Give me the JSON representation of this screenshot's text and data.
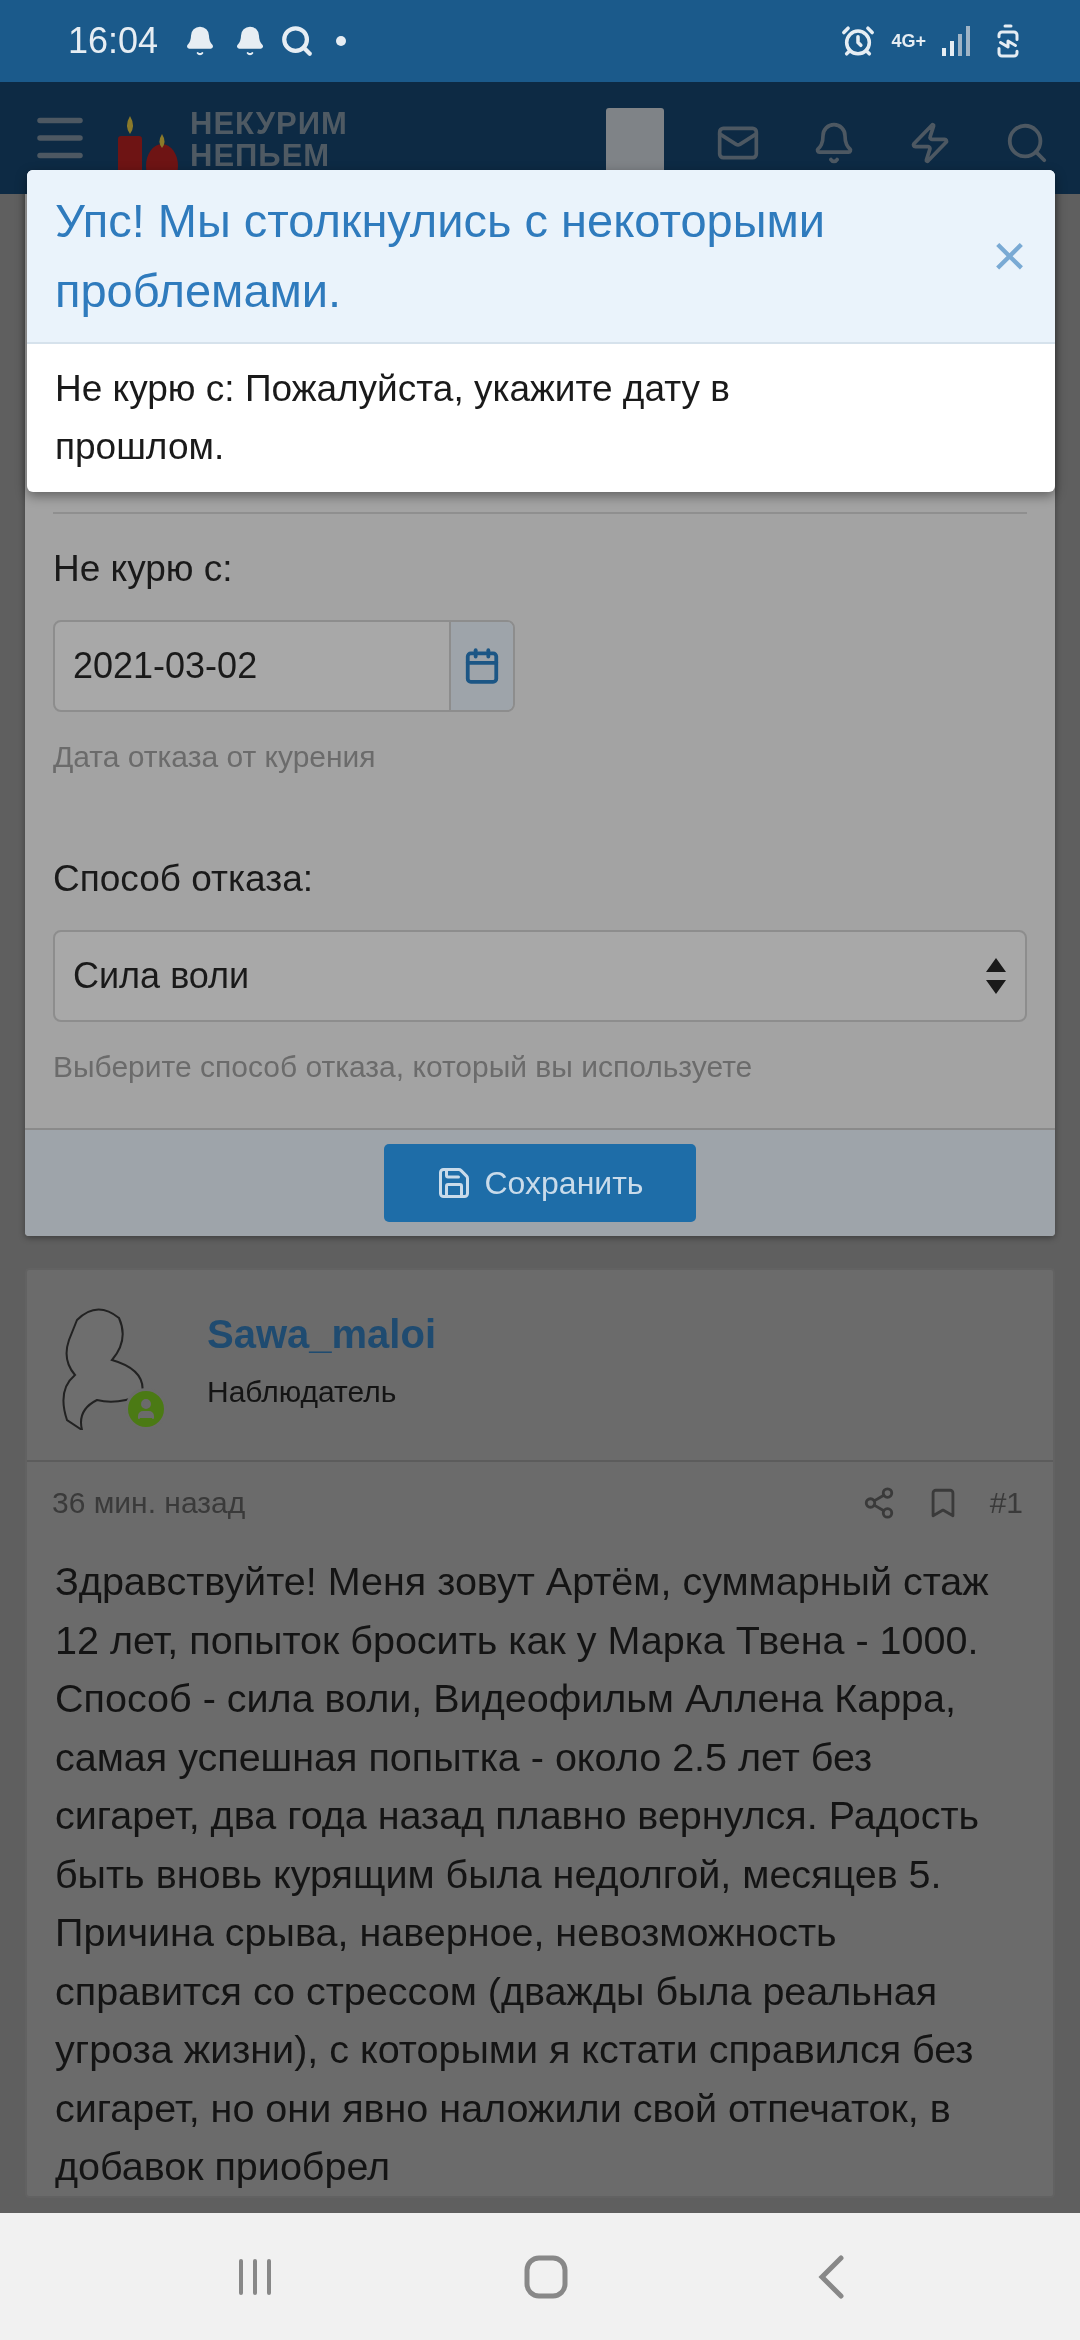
{
  "status_bar": {
    "time": "16:04",
    "network": "4G+"
  },
  "header": {
    "logo": [
      "НЕКУРИМ",
      "НЕПЬЕМ"
    ]
  },
  "error_dialog": {
    "title": "Упс! Мы столкнулись с некоторыми проблемами.",
    "close": "×",
    "message": "Не курю с: Пожалуйста, укажите дату в прошлом."
  },
  "form": {
    "fields": [
      {
        "kind": "date",
        "label": "Не курю с:",
        "value": "2021-03-02",
        "hint": "Дата отказа от курения"
      },
      {
        "kind": "select",
        "label": "Способ отказа:",
        "value": "Сила воли",
        "hint": "Выберите способ отказа, который вы используете"
      }
    ],
    "save_button": "Сохранить"
  },
  "post": {
    "author": "Sawa_maloi",
    "role": "Наблюдатель",
    "online": true,
    "time": "36 мин. назад",
    "number": "#1",
    "text": "Здравствуйте! Меня зовут Артём, суммарный стаж 12 лет, попыток бросить как у Марка Твена - 1000. Способ - сила воли, Видеофильм Аллена Карра, самая успешная попытка - около 2.5 лет без сигарет, два года назад плавно вернулся. Радость быть вновь курящим была недолгой, месяцев 5. Причина срыва, наверное, невозможность справится со стрессом (дважды была реальная угроза жизни), с которыми я кстати справился без сигарет, но они явно наложили свой отпечаток, в добавок приобрел"
  }
}
